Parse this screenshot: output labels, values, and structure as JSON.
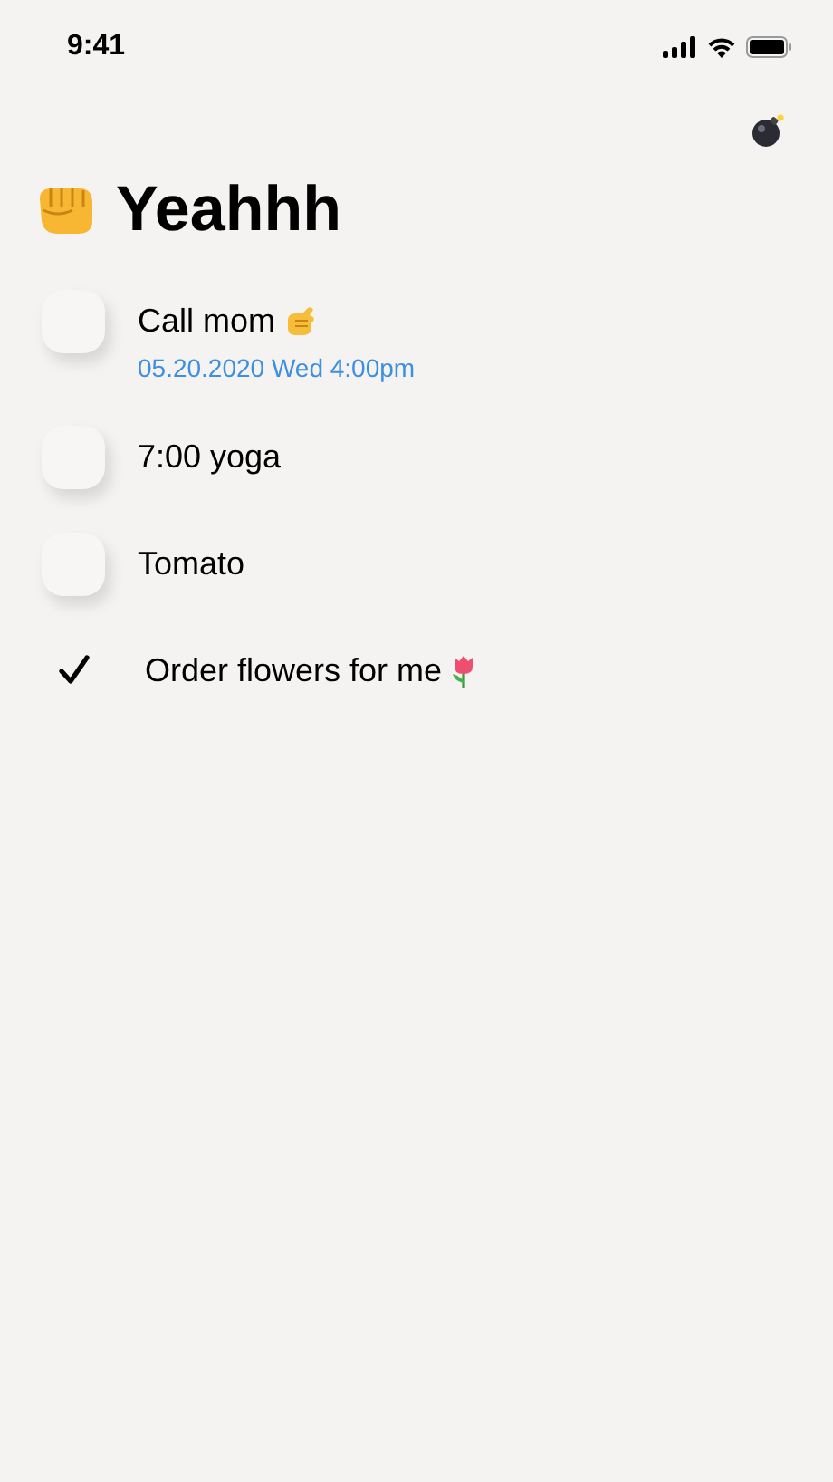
{
  "status_bar": {
    "time": "9:41"
  },
  "title": "Yeahhh",
  "tasks": [
    {
      "text": "Call mom",
      "checked": false,
      "due": "05.20.2020 Wed 4:00pm"
    },
    {
      "text": "7:00 yoga",
      "checked": false
    },
    {
      "text": "Tomato",
      "checked": false
    },
    {
      "text": "Order flowers for me",
      "checked": true
    }
  ]
}
